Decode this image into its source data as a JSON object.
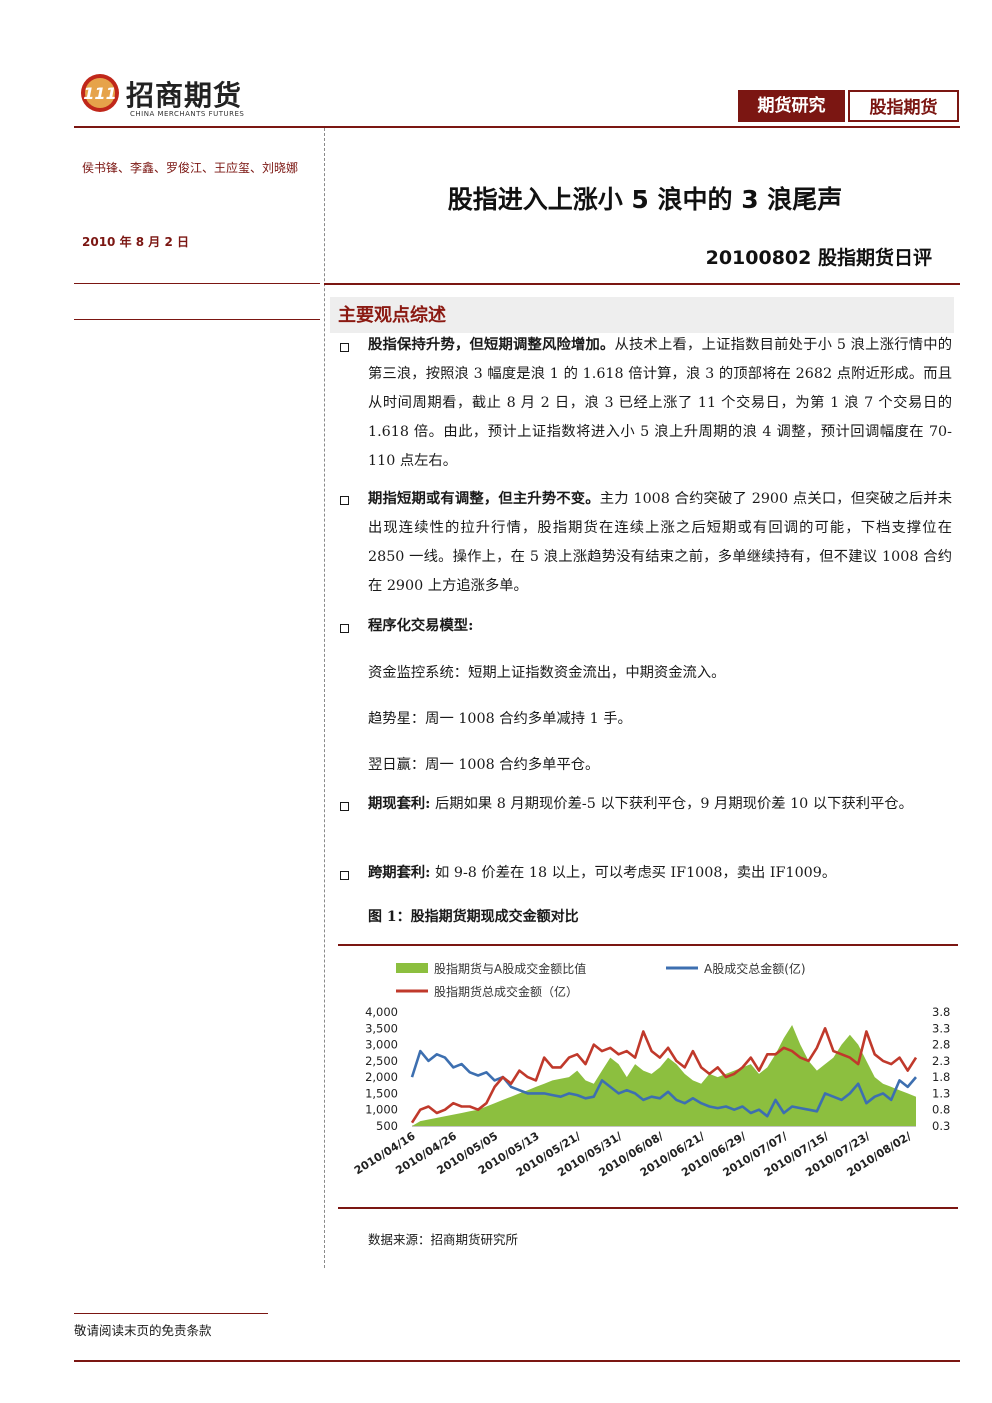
{
  "header": {
    "logo_cn": "招商期货",
    "logo_en": "CHINA MERCHANTS FUTURES",
    "tag1": "期货研究",
    "tag2": "股指期货"
  },
  "sidebar": {
    "authors": "侯书锋、李鑫、罗俊江、王应玺、刘晓娜",
    "date": "2010 年 8 月 2 日"
  },
  "report": {
    "title": "股指进入上涨小 5 浪中的 3 浪尾声",
    "subtitle": "20100802 股指期货日评",
    "section_title": "主要观点综述"
  },
  "points": [
    {
      "lead": "股指保持升势，但短期调整风险增加。",
      "text": "从技术上看，上证指数目前处于小 5 浪上涨行情中的第三浪，按照浪 3 幅度是浪 1 的 1.618 倍计算，浪 3 的顶部将在 2682 点附近形成。而且从时间周期看，截止 8 月 2 日，浪 3 已经上涨了 11 个交易日，为第 1 浪 7 个交易日的 1.618 倍。由此，预计上证指数将进入小 5 浪上升周期的浪 4 调整，预计回调幅度在 70-110 点左右。"
    },
    {
      "lead": "期指短期或有调整，但主升势不变。",
      "text": "主力 1008 合约突破了 2900 点关口，但突破之后并未出现连续性的拉升行情，股指期货在连续上涨之后短期或有回调的可能，下档支撑位在 2850 一线。操作上，在 5 浪上涨趋势没有结束之前，多单继续持有，但不建议 1008 合约在 2900 上方追涨多单。"
    },
    {
      "lead": "程序化交易模型:",
      "text": ""
    },
    {
      "lead": "期现套利:",
      "text": " 后期如果 8 月期现价差-5 以下获利平仓，9 月期现价差 10 以下获利平仓。"
    },
    {
      "lead": "跨期套利:",
      "text": " 如 9-8 价差在 18 以上，可以考虑买 IF1008，卖出 IF1009。"
    }
  ],
  "models": [
    "资金监控系统：短期上证指数资金流出，中期资金流入。",
    "趋势星：周一 1008 合约多单减持 1 手。",
    "翌日赢：周一 1008 合约多单平仓。"
  ],
  "figure": {
    "title": "图 1：股指期货期现成交金额对比",
    "source": "数据来源：招商期货研究所"
  },
  "footer": {
    "disclaimer": "敬请阅读末页的免责条款"
  },
  "colors": {
    "brand": "#7b1612",
    "ratio_area": "#8cbf3f",
    "a_share_line": "#3d6fb0",
    "futures_line": "#c0392b"
  },
  "chart_data": {
    "type": "line",
    "legend_placement": "top",
    "x_ticks": [
      "2010/04/16",
      "2010/04/26",
      "2010/05/05",
      "2010/05/13",
      "2010/05/21/",
      "2010/05/31/",
      "2010/06/08/",
      "2010/06/21/",
      "2010/06/29/",
      "2010/07/07/",
      "2010/07/15/",
      "2010/07/23/",
      "2010/08/02/"
    ],
    "y_left_ticks": [
      "4,000",
      "3,500",
      "3,000",
      "2,500",
      "2,000",
      "1,500",
      "1,000",
      "500"
    ],
    "y_right_ticks": [
      "3.8",
      "3.3",
      "2.8",
      "2.3",
      "1.8",
      "1.3",
      "0.8",
      "0.3"
    ],
    "ylim_left": [
      500,
      4000
    ],
    "ylim_right": [
      0.3,
      3.8
    ],
    "series": [
      {
        "name": "股指期货与A股成交金额比值",
        "axis": "right",
        "kind": "area",
        "values": [
          0.3,
          0.45,
          0.5,
          0.55,
          0.6,
          0.65,
          0.7,
          0.75,
          0.8,
          0.9,
          1.0,
          1.1,
          1.2,
          1.3,
          1.4,
          1.5,
          1.6,
          1.7,
          1.75,
          1.8,
          2.0,
          1.7,
          1.6,
          2.0,
          2.4,
          2.2,
          1.8,
          2.2,
          2.0,
          1.9,
          2.1,
          2.4,
          2.2,
          1.9,
          1.7,
          1.6,
          1.9,
          1.8,
          1.9,
          2.0,
          2.1,
          2.2,
          1.9,
          2.1,
          2.5,
          3.0,
          3.4,
          2.8,
          2.3,
          2.0,
          2.2,
          2.4,
          2.8,
          3.1,
          2.8,
          2.3,
          1.8,
          1.6,
          1.5,
          1.4,
          1.3,
          1.2
        ]
      },
      {
        "name": "A股成交总金额(亿)",
        "axis": "left",
        "kind": "line",
        "values": [
          2000,
          2800,
          2500,
          2700,
          2600,
          2300,
          2400,
          2150,
          2050,
          2150,
          1900,
          2000,
          1700,
          1600,
          1500,
          1500,
          1500,
          1450,
          1400,
          1500,
          1450,
          1350,
          1400,
          1900,
          1700,
          1500,
          1600,
          1500,
          1300,
          1400,
          1350,
          1550,
          1300,
          1200,
          1350,
          1200,
          1100,
          1050,
          1100,
          1000,
          1100,
          900,
          1000,
          800,
          1300,
          900,
          1100,
          1050,
          1000,
          950,
          1500,
          1400,
          1300,
          1500,
          1800,
          1200,
          1400,
          1500,
          1300,
          1900,
          1700,
          2000
        ]
      },
      {
        "name": "股指期货总成交金额（亿）",
        "axis": "left",
        "kind": "line",
        "values": [
          600,
          1000,
          1100,
          900,
          1000,
          1200,
          1100,
          1100,
          1000,
          1200,
          1700,
          2000,
          1800,
          2200,
          2000,
          1900,
          2600,
          2300,
          2300,
          2600,
          2700,
          2400,
          3000,
          2800,
          2900,
          2700,
          2800,
          2600,
          3400,
          2800,
          2600,
          2900,
          2500,
          2300,
          2800,
          2300,
          2100,
          2300,
          2000,
          2100,
          2300,
          2600,
          2200,
          2700,
          2700,
          2900,
          2800,
          2600,
          2500,
          2900,
          3500,
          2800,
          2700,
          2600,
          2400,
          3400,
          2700,
          2500,
          2400,
          2600,
          2200,
          2600
        ]
      }
    ]
  }
}
